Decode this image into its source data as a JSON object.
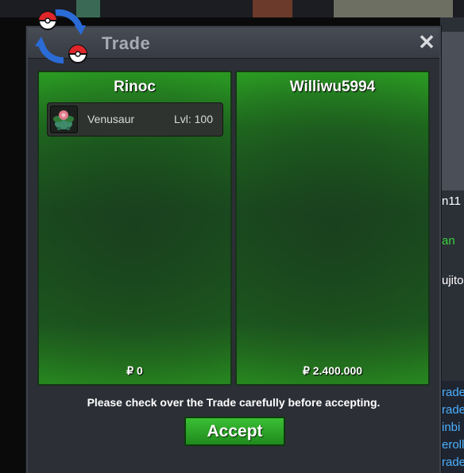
{
  "window": {
    "title": "Trade",
    "close_label": "✕"
  },
  "left_panel": {
    "player_name": "Rinoc",
    "items": [
      {
        "name": "Venusaur",
        "level": "Lvl: 100"
      }
    ],
    "money": "₽ 0"
  },
  "right_panel": {
    "player_name": "Williwu5994",
    "items": [],
    "money": "₽ 2.400.000"
  },
  "notice": "Please check over the Trade carefully before accepting.",
  "accept_label": "Accept",
  "background_side_text": [
    "n11",
    "an",
    "ujito",
    "rade",
    "rade",
    "inbi",
    "eroll",
    "rade"
  ],
  "colors": {
    "panel_green": "#1f6d1f",
    "accept_green": "#2da528",
    "window_bg": "#2c2f36"
  }
}
